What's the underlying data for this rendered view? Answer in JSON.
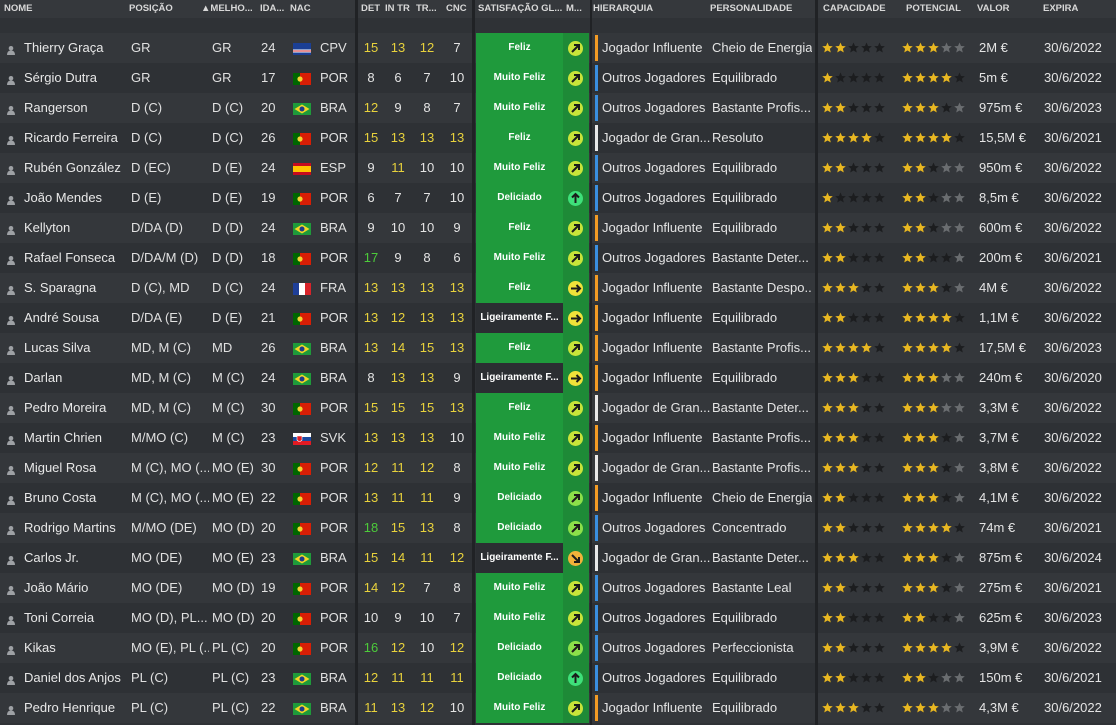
{
  "colors": {
    "attr_yellow": "#e8d23c",
    "attr_green": "#4ccb3a",
    "feliz_bg": "#1f9a3c",
    "star_gold": "#e8b722",
    "star_empty": "#6a6d70"
  },
  "header": {
    "name": "NOME",
    "position": "POSIÇÃO",
    "best": "▲MELHO...",
    "age": "IDA...",
    "nat": "NAC",
    "det": "DET",
    "intr": "IN TR",
    "tr": "TR...",
    "cnc": "CNC",
    "satisfaction": "SATISFAÇÃO GL...",
    "mood": "M...",
    "hierarchy": "HIERARQUIA",
    "personality": "PERSONALIDADE",
    "capacity": "CAPACIDADE",
    "potential": "POTENCIAL",
    "value": "VALOR",
    "expires": "EXPIRA"
  },
  "players": [
    {
      "name": "Thierry Graça",
      "pos": "GR",
      "best": "GR",
      "age": "24",
      "nat": "CPV",
      "flag": "cpv",
      "det": "15",
      "intr": "13",
      "tr": "12",
      "cnc": "7",
      "sat": "Feliz",
      "mood": "up",
      "hier": "Jogador Influente",
      "hbar": "orange",
      "pers": "Cheio de Energia",
      "cap": 2.5,
      "pot": 3,
      "pot_max": 3,
      "val": "2M €",
      "exp": "30/6/2022"
    },
    {
      "name": "Sérgio Dutra",
      "pos": "GR",
      "best": "GR",
      "age": "17",
      "nat": "POR",
      "flag": "por",
      "det": "8",
      "intr": "6",
      "tr": "7",
      "cnc": "10",
      "sat": "Muito Feliz",
      "mood": "up",
      "hier": "Outros Jogadores",
      "hbar": "blue",
      "pers": "Equilibrado",
      "cap": 1.5,
      "pot": 4,
      "pot_max": 5,
      "val": "5m €",
      "exp": "30/6/2022"
    },
    {
      "name": "Rangerson",
      "pos": "D (C)",
      "best": "D (C)",
      "age": "20",
      "nat": "BRA",
      "flag": "bra",
      "det": "12",
      "intr": "9",
      "tr": "8",
      "cnc": "7",
      "sat": "Muito Feliz",
      "mood": "up",
      "hier": "Outros Jogadores",
      "hbar": "blue",
      "pers": "Bastante Profis...",
      "cap": 2,
      "pot": 3,
      "pot_max": 4,
      "val": "975m €",
      "exp": "30/6/2023"
    },
    {
      "name": "Ricardo Ferreira",
      "pos": "D (C)",
      "best": "D (C)",
      "age": "26",
      "nat": "POR",
      "flag": "por",
      "det": "15",
      "intr": "13",
      "tr": "13",
      "cnc": "13",
      "sat": "Feliz",
      "mood": "up",
      "hier": "Jogador de Gran...",
      "hbar": "white",
      "pers": "Resoluto",
      "cap": 4,
      "pot": 4.5,
      "pot_max": 4.5,
      "val": "15,5M €",
      "exp": "30/6/2021"
    },
    {
      "name": "Rubén González",
      "pos": "D (EC)",
      "best": "D (E)",
      "age": "24",
      "nat": "ESP",
      "flag": "esp",
      "det": "9",
      "intr": "11",
      "tr": "10",
      "cnc": "10",
      "sat": "Muito Feliz",
      "mood": "up",
      "hier": "Outros Jogadores",
      "hbar": "blue",
      "pers": "Equilibrado",
      "cap": 2.5,
      "pot": 2.5,
      "pot_max": 2.5,
      "val": "950m €",
      "exp": "30/6/2022"
    },
    {
      "name": "João Mendes",
      "pos": "D (E)",
      "best": "D (E)",
      "age": "19",
      "nat": "POR",
      "flag": "por",
      "det": "6",
      "intr": "7",
      "tr": "7",
      "cnc": "10",
      "sat": "Deliciado",
      "mood": "delight",
      "hier": "Outros Jogadores",
      "hbar": "blue",
      "pers": "Equilibrado",
      "cap": 1.5,
      "pot": 2,
      "pot_max": 3,
      "val": "8,5m €",
      "exp": "30/6/2022"
    },
    {
      "name": "Kellyton",
      "pos": "D/DA (D)",
      "best": "D (D)",
      "age": "24",
      "nat": "BRA",
      "flag": "bra",
      "det": "9",
      "intr": "10",
      "tr": "10",
      "cnc": "9",
      "sat": "Feliz",
      "mood": "up",
      "hier": "Jogador Influente",
      "hbar": "orange",
      "pers": "Equilibrado",
      "cap": 2.5,
      "pot": 2.5,
      "pot_max": 2.5,
      "val": "600m €",
      "exp": "30/6/2022"
    },
    {
      "name": "Rafael Fonseca",
      "pos": "D/DA/M (D)",
      "best": "D (D)",
      "age": "18",
      "nat": "POR",
      "flag": "por",
      "det": "17",
      "intr": "9",
      "tr": "8",
      "cnc": "6",
      "sat": "Muito Feliz",
      "mood": "up",
      "hier": "Outros Jogadores",
      "hbar": "blue",
      "pers": "Bastante Deter...",
      "cap": 2.5,
      "pot": 2.5,
      "pot_max": 3.5,
      "val": "200m €",
      "exp": "30/6/2021"
    },
    {
      "name": "S. Sparagna",
      "pos": "D (C), MD",
      "best": "D (C)",
      "age": "24",
      "nat": "FRA",
      "flag": "fra",
      "det": "13",
      "intr": "13",
      "tr": "13",
      "cnc": "13",
      "sat": "Feliz",
      "mood": "right",
      "hier": "Jogador Influente",
      "hbar": "orange",
      "pers": "Bastante Despo...",
      "cap": 3.5,
      "pot": 3.5,
      "pot_max": 3.5,
      "val": "4M €",
      "exp": "30/6/2022"
    },
    {
      "name": "André Sousa",
      "pos": "D/DA (E)",
      "best": "D (E)",
      "age": "21",
      "nat": "POR",
      "flag": "por",
      "det": "13",
      "intr": "12",
      "tr": "13",
      "cnc": "13",
      "sat": "Ligeiramente F...",
      "mood": "right",
      "hier": "Jogador Influente",
      "hbar": "orange",
      "pers": "Equilibrado",
      "cap": 2.5,
      "pot": 4.5,
      "pot_max": 5,
      "val": "1,1M €",
      "exp": "30/6/2022"
    },
    {
      "name": "Lucas Silva",
      "pos": "MD, M (C)",
      "best": "MD",
      "age": "26",
      "nat": "BRA",
      "flag": "bra",
      "det": "13",
      "intr": "14",
      "tr": "15",
      "cnc": "13",
      "sat": "Feliz",
      "mood": "up",
      "hier": "Jogador Influente",
      "hbar": "orange",
      "pers": "Bastante Profis...",
      "cap": 4.5,
      "pot": 4.5,
      "pot_max": 4.5,
      "val": "17,5M €",
      "exp": "30/6/2023"
    },
    {
      "name": "Darlan",
      "pos": "MD, M (C)",
      "best": "M (C)",
      "age": "24",
      "nat": "BRA",
      "flag": "bra",
      "det": "8",
      "intr": "13",
      "tr": "13",
      "cnc": "9",
      "sat": "Ligeiramente F...",
      "mood": "right",
      "hier": "Jogador Influente",
      "hbar": "orange",
      "pers": "Equilibrado",
      "cap": 3,
      "pot": 3,
      "pot_max": 3,
      "val": "240m €",
      "exp": "30/6/2020"
    },
    {
      "name": "Pedro Moreira",
      "pos": "MD, M (C)",
      "best": "M (C)",
      "age": "30",
      "nat": "POR",
      "flag": "por",
      "det": "15",
      "intr": "15",
      "tr": "15",
      "cnc": "13",
      "sat": "Feliz",
      "mood": "up",
      "hier": "Jogador de Gran...",
      "hbar": "white",
      "pers": "Bastante Deter...",
      "cap": 3,
      "pot": 3,
      "pot_max": 3,
      "val": "3,3M €",
      "exp": "30/6/2022"
    },
    {
      "name": "Martin Chrien",
      "pos": "M/MO (C)",
      "best": "M (C)",
      "age": "23",
      "nat": "SVK",
      "flag": "svk",
      "det": "13",
      "intr": "13",
      "tr": "13",
      "cnc": "10",
      "sat": "Muito Feliz",
      "mood": "up",
      "hier": "Jogador Influente",
      "hbar": "orange",
      "pers": "Bastante Profis...",
      "cap": 3.5,
      "pot": 3.5,
      "pot_max": 3.5,
      "val": "3,7M €",
      "exp": "30/6/2022"
    },
    {
      "name": "Miguel Rosa",
      "pos": "M (C), MO (...",
      "best": "MO (E)",
      "age": "30",
      "nat": "POR",
      "flag": "por",
      "det": "12",
      "intr": "11",
      "tr": "12",
      "cnc": "8",
      "sat": "Muito Feliz",
      "mood": "up",
      "hier": "Jogador de Gran...",
      "hbar": "white",
      "pers": "Bastante Profis...",
      "cap": 3.5,
      "pot": 3.5,
      "pot_max": 3.5,
      "val": "3,8M €",
      "exp": "30/6/2022"
    },
    {
      "name": "Bruno Costa",
      "pos": "M (C), MO (...",
      "best": "MO (E)",
      "age": "22",
      "nat": "POR",
      "flag": "por",
      "det": "13",
      "intr": "11",
      "tr": "11",
      "cnc": "9",
      "sat": "Deliciado",
      "mood": "upright",
      "hier": "Jogador Influente",
      "hbar": "orange",
      "pers": "Cheio de Energia",
      "cap": 2.5,
      "pot": 3.5,
      "pot_max": 3.5,
      "val": "4,1M €",
      "exp": "30/6/2022"
    },
    {
      "name": "Rodrigo Martins",
      "pos": "M/MO (DE)",
      "best": "MO (D)",
      "age": "20",
      "nat": "POR",
      "flag": "por",
      "det": "18",
      "intr": "15",
      "tr": "13",
      "cnc": "8",
      "sat": "Deliciado",
      "mood": "upright",
      "hier": "Outros Jogadores",
      "hbar": "blue",
      "pers": "Concentrado",
      "cap": 2,
      "pot": 4,
      "pot_max": 5,
      "val": "74m €",
      "exp": "30/6/2021"
    },
    {
      "name": "Carlos Jr.",
      "pos": "MO (DE)",
      "best": "MO (E)",
      "age": "23",
      "nat": "BRA",
      "flag": "bra",
      "det": "15",
      "intr": "14",
      "tr": "11",
      "cnc": "12",
      "sat": "Ligeiramente F...",
      "mood": "downright",
      "hier": "Jogador de Gran...",
      "hbar": "white",
      "pers": "Bastante Deter...",
      "cap": 3.5,
      "pot": 3.5,
      "pot_max": 3.5,
      "val": "875m €",
      "exp": "30/6/2024"
    },
    {
      "name": "João Mário",
      "pos": "MO (DE)",
      "best": "MO (D)",
      "age": "19",
      "nat": "POR",
      "flag": "por",
      "det": "14",
      "intr": "12",
      "tr": "7",
      "cnc": "8",
      "sat": "Muito Feliz",
      "mood": "up",
      "hier": "Outros Jogadores",
      "hbar": "blue",
      "pers": "Bastante Leal",
      "cap": 2.5,
      "pot": 3,
      "pot_max": 4,
      "val": "275m €",
      "exp": "30/6/2021"
    },
    {
      "name": "Toni Correia",
      "pos": "MO (D), PL...",
      "best": "MO (D)",
      "age": "20",
      "nat": "POR",
      "flag": "por",
      "det": "10",
      "intr": "9",
      "tr": "10",
      "cnc": "7",
      "sat": "Muito Feliz",
      "mood": "up",
      "hier": "Outros Jogadores",
      "hbar": "blue",
      "pers": "Equilibrado",
      "cap": 2.5,
      "pot": 2.5,
      "pot_max": 3.5,
      "val": "625m €",
      "exp": "30/6/2023"
    },
    {
      "name": "Kikas",
      "pos": "MO (E), PL (...",
      "best": "PL (C)",
      "age": "20",
      "nat": "POR",
      "flag": "por",
      "det": "16",
      "intr": "12",
      "tr": "10",
      "cnc": "12",
      "sat": "Deliciado",
      "mood": "upright",
      "hier": "Outros Jogadores",
      "hbar": "blue",
      "pers": "Perfeccionista",
      "cap": 2.5,
      "pot": 4,
      "pot_max": 5,
      "val": "3,9M €",
      "exp": "30/6/2022"
    },
    {
      "name": "Daniel dos Anjos",
      "pos": "PL (C)",
      "best": "PL (C)",
      "age": "23",
      "nat": "BRA",
      "flag": "bra",
      "det": "12",
      "intr": "11",
      "tr": "11",
      "cnc": "11",
      "sat": "Deliciado",
      "mood": "delight",
      "hier": "Outros Jogadores",
      "hbar": "blue",
      "pers": "Equilibrado",
      "cap": 2.5,
      "pot": 2.5,
      "pot_max": 2.5,
      "val": "150m €",
      "exp": "30/6/2021"
    },
    {
      "name": "Pedro Henrique",
      "pos": "PL (C)",
      "best": "PL (C)",
      "age": "22",
      "nat": "BRA",
      "flag": "bra",
      "det": "11",
      "intr": "13",
      "tr": "12",
      "cnc": "10",
      "sat": "Muito Feliz",
      "mood": "up",
      "hier": "Jogador Influente",
      "hbar": "orange",
      "pers": "Equilibrado",
      "cap": 3,
      "pot": 3,
      "pot_max": 3,
      "val": "4,3M €",
      "exp": "30/6/2022"
    }
  ]
}
